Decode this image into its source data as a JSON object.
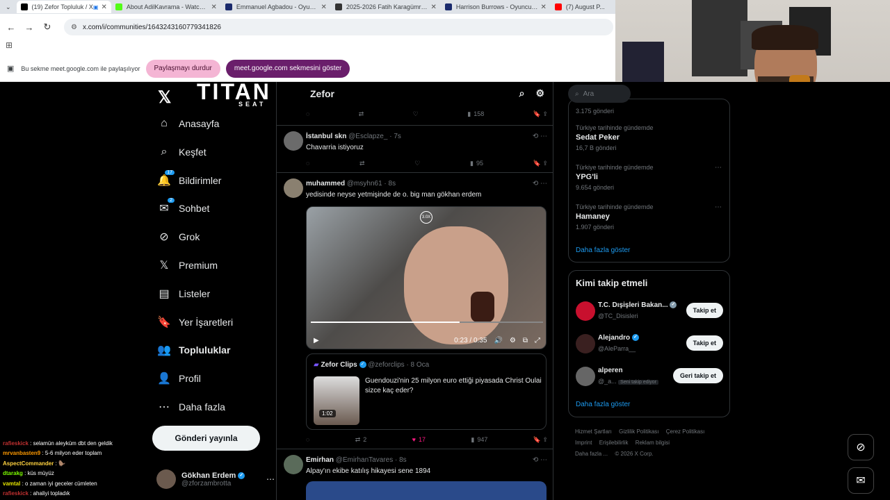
{
  "tabs": [
    {
      "title": "(19) Zefor Topluluk / X",
      "color": "#000000",
      "active": true
    },
    {
      "title": "About AdilKavrama - Watch Li...",
      "color": "#53fc18"
    },
    {
      "title": "Emmanuel Agbadou - Oyuncu...",
      "color": "#1a2a6c"
    },
    {
      "title": "2025-2026 Fatih Karagümrük S...",
      "color": "#333333"
    },
    {
      "title": "Harrison Burrows - Oyuncu pro...",
      "color": "#1a2a6c"
    },
    {
      "title": "(7) August P...",
      "color": "#ff0000"
    }
  ],
  "address": {
    "url": "x.com/i/communities/1643243160779341826"
  },
  "share": {
    "text": "Bu sekme meet.google.com ile paylaşılıyor",
    "stop": "Paylaşmayı durdur",
    "show": "meet.google.com sekmesini göster"
  },
  "brand": {
    "titan": "TITAN",
    "seat": "SEAT"
  },
  "nav": {
    "items": [
      {
        "label": "Anasayfa",
        "icon": "home-icon",
        "glyph": "⌂"
      },
      {
        "label": "Keşfet",
        "icon": "search-icon",
        "glyph": "⌕"
      },
      {
        "label": "Bildirimler",
        "icon": "bell-icon",
        "glyph": "🔔",
        "badge": "17"
      },
      {
        "label": "Sohbet",
        "icon": "mail-icon",
        "glyph": "✉",
        "badge": "2"
      },
      {
        "label": "Grok",
        "icon": "grok-icon",
        "glyph": "⊘"
      },
      {
        "label": "Premium",
        "icon": "x-icon",
        "glyph": "𝕏"
      },
      {
        "label": "Listeler",
        "icon": "list-icon",
        "glyph": "▤"
      },
      {
        "label": "Yer İşaretleri",
        "icon": "bookmark-icon",
        "glyph": "🔖"
      },
      {
        "label": "Topluluklar",
        "icon": "communities-icon",
        "glyph": "👥",
        "bold": true
      },
      {
        "label": "Profil",
        "icon": "profile-icon",
        "glyph": "👤"
      },
      {
        "label": "Daha fazla",
        "icon": "more-icon",
        "glyph": "⋯"
      }
    ],
    "post_button": "Gönderi yayınla",
    "account": {
      "name": "Gökhan Erdem",
      "handle": "@zforzambrotta"
    }
  },
  "feed": {
    "title": "Zefor",
    "top_actions": {
      "views": "158"
    },
    "posts": [
      {
        "name": "İstanbul skn",
        "handle": "@Esclapze_",
        "time": "· 7s",
        "text": "Chavarria istiyoruz",
        "views": "95",
        "avatar": "#6b6b6b"
      },
      {
        "name": "muhammed",
        "handle": "@msyhn61",
        "time": "· 8s",
        "text": "yedisinde neyse yetmişinde de o. big man gökhan erdem",
        "avatar": "#8a8070",
        "video": {
          "time": "0:23 / 0:35",
          "speed": "3.0X"
        },
        "quote": {
          "name": "Zefor Clips",
          "handle": "@zeforclips",
          "time": "· 8 Oca",
          "text": "Guendouzi'nin 25 milyon euro ettiği piyasada Christ Oulai sizce kaç eder?",
          "duration": "1:02"
        },
        "reposts": "2",
        "likes": "17",
        "views": "947"
      },
      {
        "name": "Emirhan",
        "handle": "@EmirhanTavares",
        "time": "· 8s",
        "text": "Alpay'ın ekibe katılış hikayesi sene 1894",
        "avatar": "#5a6b5a"
      }
    ]
  },
  "right": {
    "search_placeholder": "Ara",
    "trends": [
      {
        "category": "",
        "name": "",
        "posts": "3.175 gönderi"
      },
      {
        "category": "Türkiye tarihinde gündemde",
        "name": "Sedat Peker",
        "posts": "16,7 B gönderi"
      },
      {
        "category": "Türkiye tarihinde gündemde",
        "name": "YPG'li",
        "posts": "9.654 gönderi"
      },
      {
        "category": "Türkiye tarihinde gündemde",
        "name": "Hamaney",
        "posts": "1.907 gönderi"
      }
    ],
    "show_more": "Daha fazla göster",
    "who_title": "Kimi takip etmeli",
    "who": [
      {
        "name": "T.C. Dışişleri Bakan...",
        "handle": "@TC_Disisleri",
        "button": "Takip et",
        "avatar": "#c8102e",
        "verified": "gray"
      },
      {
        "name": "Alejandro",
        "handle": "@AleParra__",
        "button": "Takip et",
        "avatar": "#3a2020",
        "verified": "blue"
      },
      {
        "name": "alperen",
        "handle": "@_a...",
        "extra": "Seni takip ediyor",
        "button": "Geri takip et",
        "avatar": "#666666"
      }
    ],
    "who_more": "Daha fazla göster",
    "footer": [
      "Hizmet Şartları",
      "Gizlilik Politikası",
      "Çerez Politikası",
      "Imprint",
      "Erişilebilirlik",
      "Reklam bilgisi",
      "Daha fazla ...",
      "© 2026 X Corp."
    ]
  },
  "chat": [
    {
      "user": "rafieskick",
      "text": "selamün aleyküm dbt den geldik",
      "color": "#c03030"
    },
    {
      "user": "mrvanbasten9",
      "text": "5-6 milyon eder toplam",
      "color": "#ff9a00"
    },
    {
      "user": "AspectCommander",
      "text": "🦫",
      "color": "#ffd23f"
    },
    {
      "user": "dtarakg",
      "text": "küs müyüz",
      "color": "#7cfc00"
    },
    {
      "user": "vamtal",
      "text": "o zaman iyi geceler cümleten",
      "color": "#e6e600"
    },
    {
      "user": "rafieskick",
      "text": "ahaliyi topladık",
      "color": "#c03030"
    }
  ]
}
